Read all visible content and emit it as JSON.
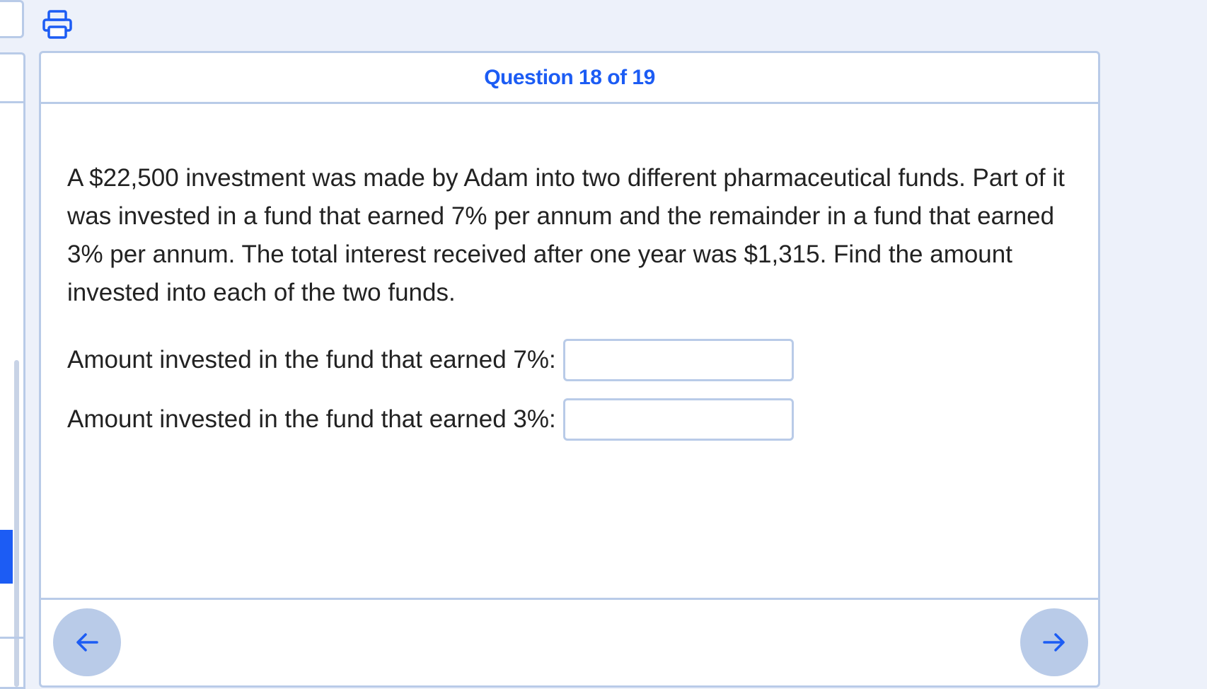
{
  "header": {
    "title": "Question 18 of 19"
  },
  "question": {
    "text": "A $22,500 investment was made by Adam into two different pharmaceutical funds. Part of it was invested in a fund that earned 7% per annum and the remainder in a fund that earned 3% per annum. The total interest received after one year was $1,315. Find the amount invested into each of the two funds."
  },
  "answers": [
    {
      "label": "Amount invested in the fund that earned 7%:",
      "value": "",
      "placeholder": ""
    },
    {
      "label": "Amount invested in the fund that earned 3%:",
      "value": "",
      "placeholder": ""
    }
  ],
  "icons": {
    "print": "printer-icon",
    "prev": "arrow-left-icon",
    "next": "arrow-right-icon"
  },
  "colors": {
    "accent": "#1c5cf4",
    "border": "#b9cbe8",
    "background": "#edf1fa",
    "nav_button": "#b9cbe8"
  }
}
